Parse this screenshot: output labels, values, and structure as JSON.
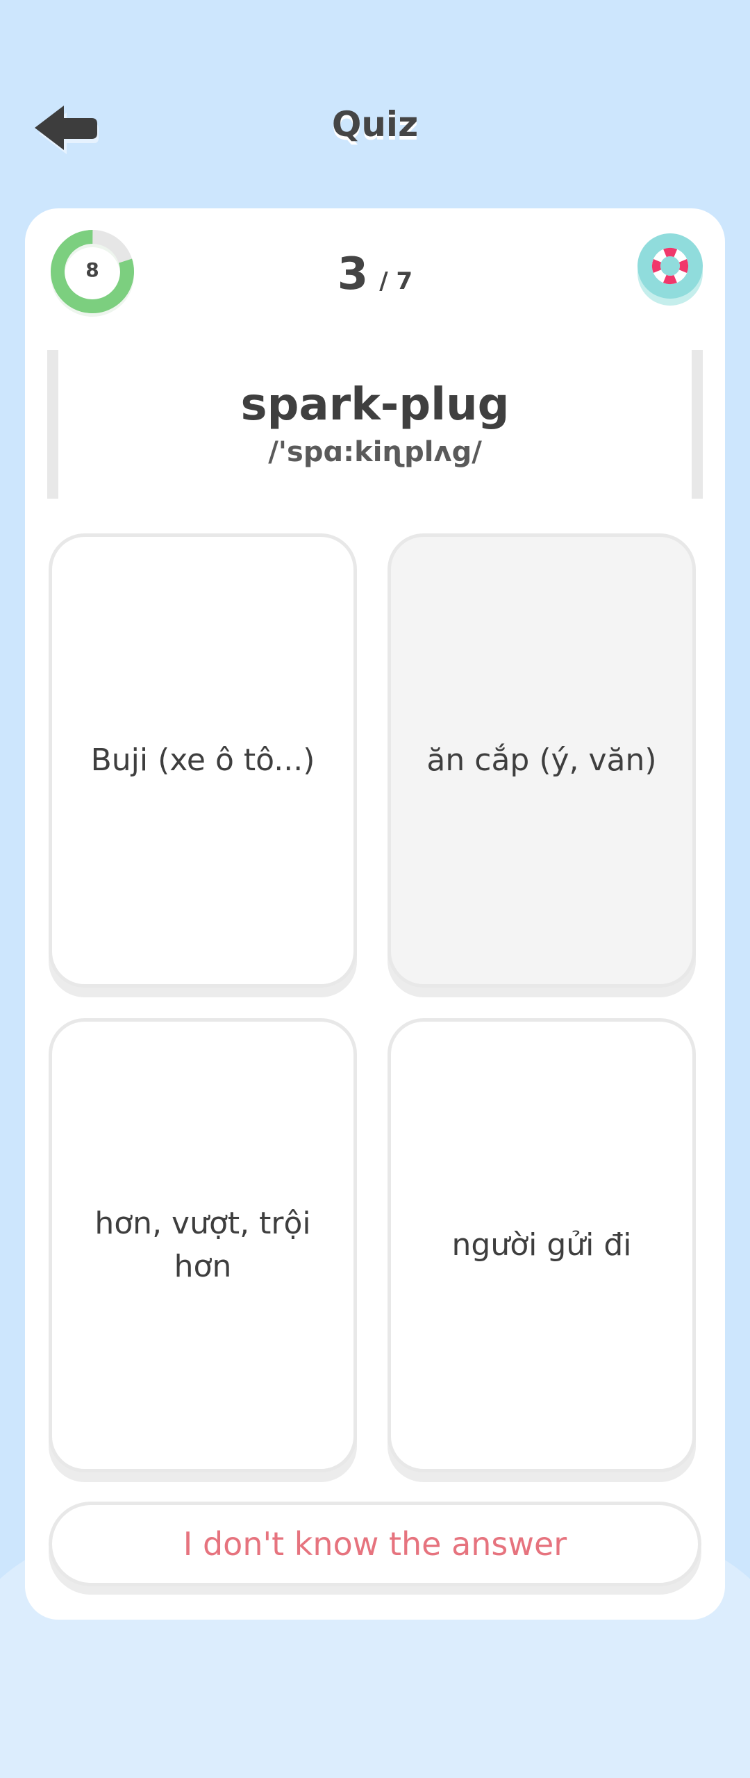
{
  "header": {
    "title": "Quiz",
    "back_icon": "arrow-left-icon"
  },
  "colors": {
    "background": "#cde6fd",
    "card": "#ffffff",
    "timer_ring": "#7ccf7f",
    "timer_track": "#e6e6e6",
    "lifebuoy_bg": "#90dcdc",
    "lifebuoy_ring": "#f0386b",
    "dont_know_text": "#e6737e"
  },
  "quiz": {
    "timer_value": "8",
    "timer_fraction_remaining": 0.8,
    "current": "3",
    "total": "/ 7",
    "help_icon": "lifebuoy-icon",
    "word": "spark-plug",
    "phonetic": "/'spɑ:kiɳplʌg/",
    "options": [
      "Buji (xe ô tô...)",
      "ăn cắp (ý, văn)",
      "hơn, vượt, trội hơn",
      "người gửi đi"
    ],
    "dont_know_label": "I don't know the answer"
  }
}
